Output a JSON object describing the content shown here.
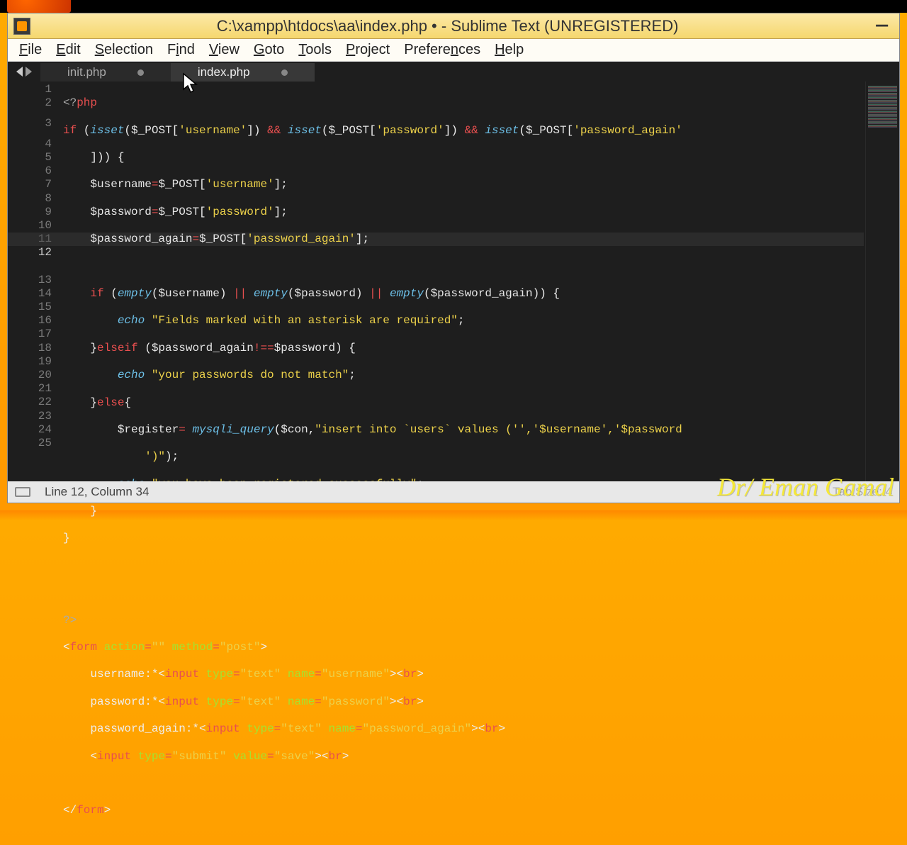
{
  "title": "C:\\xampp\\htdocs\\aa\\index.php • - Sublime Text (UNREGISTERED)",
  "menu": {
    "file": "File",
    "edit": "Edit",
    "selection": "Selection",
    "find": "Find",
    "view": "View",
    "goto": "Goto",
    "tools": "Tools",
    "project": "Project",
    "preferences": "Preferences",
    "help": "Help"
  },
  "tabs": {
    "tab1": "init.php",
    "tab2": "index.php"
  },
  "status": {
    "position": "Line 12, Column 34",
    "tabsize": "Tab Size: 4"
  },
  "watermark": "Dr/ Eman Gamal",
  "lines": {
    "count": 25
  },
  "code": {
    "l1": "<?php",
    "l2_if": "if",
    "l2_isset": "isset",
    "l2_post": "$_POST",
    "l2_username": "'username'",
    "l2_and": "&&",
    "l2_password": "'password'",
    "l2_password_again": "'password_again'",
    "l3_username_var": "$username",
    "l3_username_str": "'username'",
    "l4_password_var": "$password",
    "l4_password_str": "'password'",
    "l5_pa_var": "$password_again",
    "l5_pa_str": "'password_again'",
    "l7_empty": "empty",
    "l7_or": "||",
    "l8_echo": "echo",
    "l8_str": "\"Fields marked with an asterisk are required\"",
    "l9_elseif": "elseif",
    "l9_neq": "!==",
    "l10_str": "\"your passwords do not match\"",
    "l11_else": "else",
    "l12_register": "$register",
    "l12_mysqli": "mysqli_query",
    "l12_con": "$con",
    "l12_sql": "\"insert into `users` values ('','$username','$password",
    "l12b_sql": "')\"",
    "l13_str": "\"you have been registered successfully\"",
    "l18_close": "?>",
    "l19_form": "form",
    "l19_action": "action",
    "l19_method": "method",
    "l19_post": "\"post\"",
    "l20_label": "username:*",
    "l20_input": "input",
    "l20_type": "type",
    "l20_text": "\"text\"",
    "l20_name": "name",
    "l20_uname": "\"username\"",
    "l20_br": "br",
    "l21_label": "password:*",
    "l21_pname": "\"password\"",
    "l22_label": "password_again:*",
    "l22_paname": "\"password_again\"",
    "l23_submit": "\"submit\"",
    "l23_value": "value",
    "l23_save": "\"save\"",
    "l25_form": "form"
  }
}
